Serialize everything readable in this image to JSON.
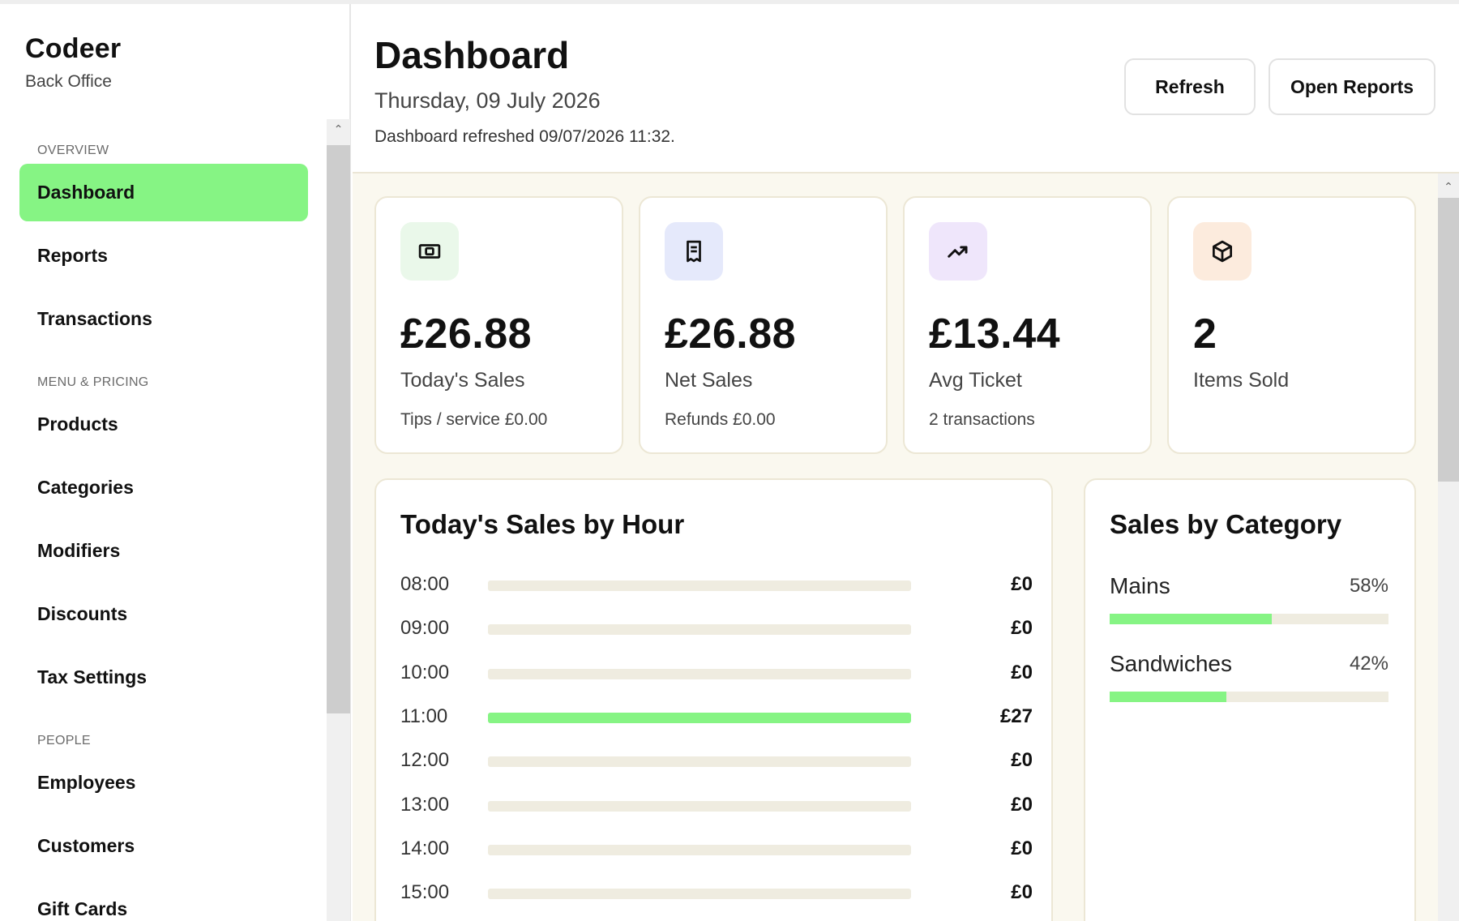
{
  "brand": {
    "title": "Codeer",
    "subtitle": "Back Office"
  },
  "nav": {
    "sections": {
      "overview": "OVERVIEW",
      "menu_pricing": "MENU & PRICING",
      "people": "PEOPLE"
    },
    "items": {
      "dashboard": "Dashboard",
      "reports": "Reports",
      "transactions": "Transactions",
      "products": "Products",
      "categories": "Categories",
      "modifiers": "Modifiers",
      "discounts": "Discounts",
      "tax_settings": "Tax Settings",
      "employees": "Employees",
      "customers": "Customers",
      "gift_cards": "Gift Cards"
    },
    "active": "Dashboard"
  },
  "header": {
    "title": "Dashboard",
    "date": "Thursday, 09 July 2026",
    "status": "Dashboard refreshed 09/07/2026 11:32.",
    "refresh_label": "Refresh",
    "open_reports_label": "Open Reports"
  },
  "kpis": [
    {
      "icon": "cash-icon",
      "value": "£26.88",
      "label": "Today's Sales",
      "sub": "Tips / service £0.00",
      "icon_bg": "#eaf8ea"
    },
    {
      "icon": "receipt-icon",
      "value": "£26.88",
      "label": "Net Sales",
      "sub": "Refunds £0.00",
      "icon_bg": "#e5e9fb"
    },
    {
      "icon": "trending-up-icon",
      "value": "£13.44",
      "label": "Avg Ticket",
      "sub": "2 transactions",
      "icon_bg": "#efe6fb"
    },
    {
      "icon": "box-icon",
      "value": "2",
      "label": "Items Sold",
      "sub": "",
      "icon_bg": "#fcebdd"
    }
  ],
  "sales_by_hour": {
    "title": "Today's Sales by Hour",
    "rows": [
      {
        "hour": "08:00",
        "value": "£0",
        "fraction": 0
      },
      {
        "hour": "09:00",
        "value": "£0",
        "fraction": 0
      },
      {
        "hour": "10:00",
        "value": "£0",
        "fraction": 0
      },
      {
        "hour": "11:00",
        "value": "£27",
        "fraction": 1
      },
      {
        "hour": "12:00",
        "value": "£0",
        "fraction": 0
      },
      {
        "hour": "13:00",
        "value": "£0",
        "fraction": 0
      },
      {
        "hour": "14:00",
        "value": "£0",
        "fraction": 0
      },
      {
        "hour": "15:00",
        "value": "£0",
        "fraction": 0
      }
    ]
  },
  "sales_by_category": {
    "title": "Sales by Category",
    "rows": [
      {
        "name": "Mains",
        "pct_label": "58%",
        "fraction": 0.58
      },
      {
        "name": "Sandwiches",
        "pct_label": "42%",
        "fraction": 0.42
      }
    ]
  },
  "colors": {
    "accent": "#86f484",
    "track": "#efece0",
    "background": "#faf8ef"
  }
}
